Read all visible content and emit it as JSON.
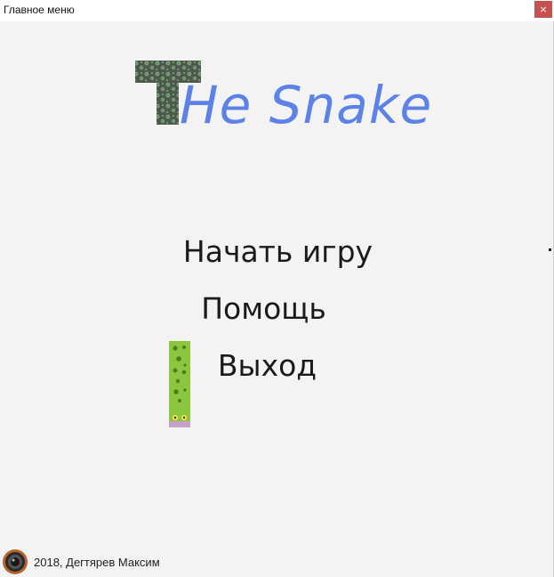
{
  "window": {
    "title": "Главное меню",
    "close_glyph": "×"
  },
  "logo": {
    "first_letter": "T",
    "rest_text": "He Snake",
    "text_color": "#5c82e8",
    "tile_style": "mossy-stone"
  },
  "menu": {
    "items": [
      {
        "label": "Начать игру"
      },
      {
        "label": "Помощь"
      },
      {
        "label": "Выход"
      }
    ],
    "cursor_icon": "snake-icon"
  },
  "footer": {
    "text": "2018, Дегтярев Максим",
    "avatar_icon": "camera-lens-icon"
  }
}
